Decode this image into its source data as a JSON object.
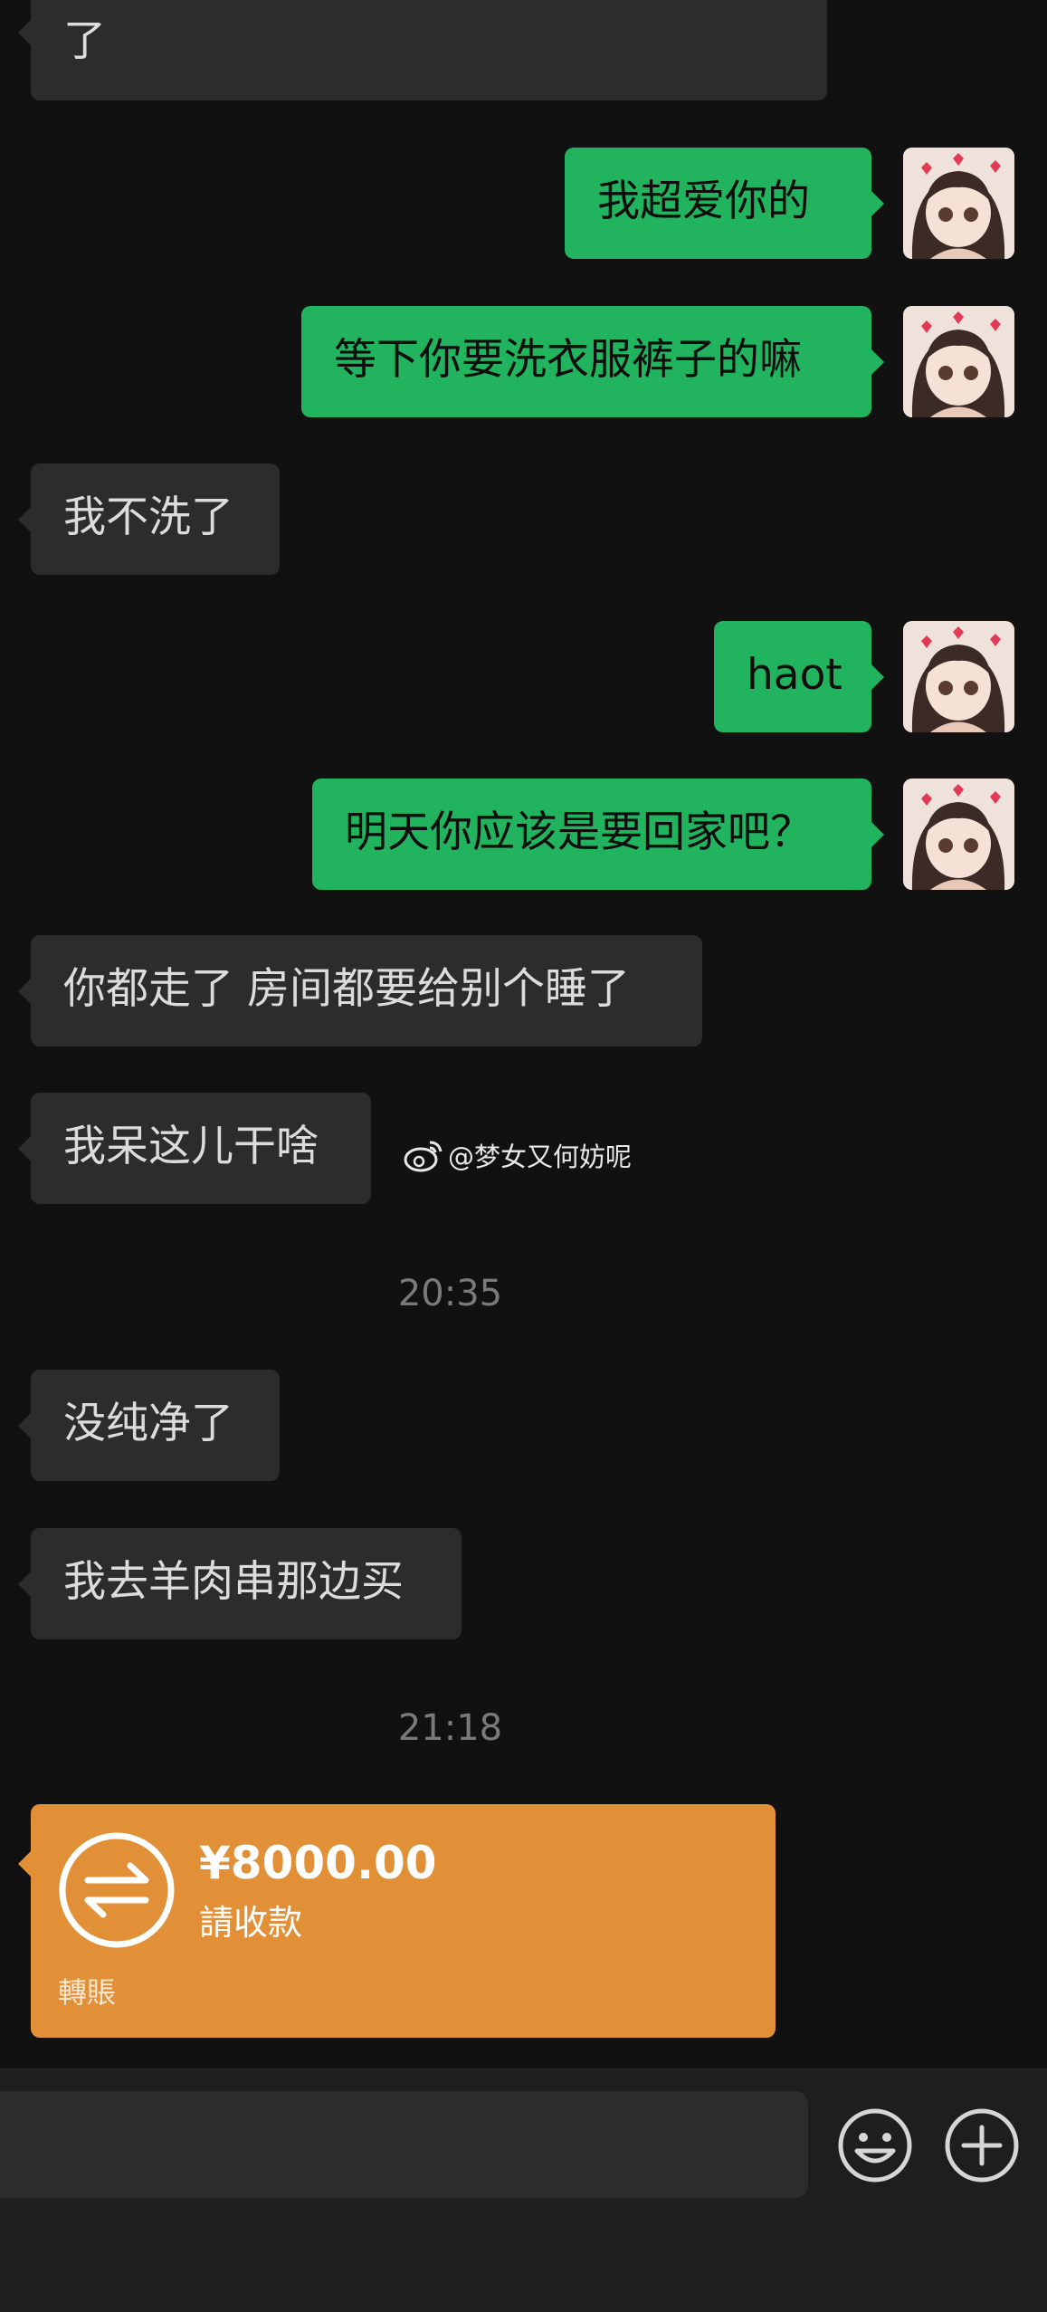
{
  "messages": [
    {
      "side": "in",
      "text": "了"
    },
    {
      "side": "out",
      "text": "我超爱你的"
    },
    {
      "side": "out",
      "text": "等下你要洗衣服裤子的嘛"
    },
    {
      "side": "in",
      "text": "我不洗了"
    },
    {
      "side": "out",
      "text": "haot"
    },
    {
      "side": "out",
      "text": "明天你应该是要回家吧？"
    },
    {
      "side": "in",
      "text": "你都走了 房间都要给别个睡了"
    },
    {
      "side": "in",
      "text": "我呆这儿干啥"
    },
    {
      "side": "in",
      "text": "没纯净了"
    },
    {
      "side": "in",
      "text": "我去羊肉串那边买"
    }
  ],
  "timestamps": [
    "20:35",
    "21:18"
  ],
  "watermark": {
    "icon": "weibo-icon",
    "handle": "@梦女又何妨呢"
  },
  "transfer": {
    "amount": "¥8000.00",
    "status": "請收款",
    "label": "轉賬",
    "icon": "transfer-arrows-icon",
    "color": "#e29037"
  },
  "input_bar": {
    "value": "",
    "emoji_icon": "emoji-icon",
    "plus_icon": "plus-circle-icon"
  },
  "colors": {
    "background": "#111111",
    "incoming_bubble": "#2c2c2c",
    "outgoing_bubble": "#21b35d"
  }
}
